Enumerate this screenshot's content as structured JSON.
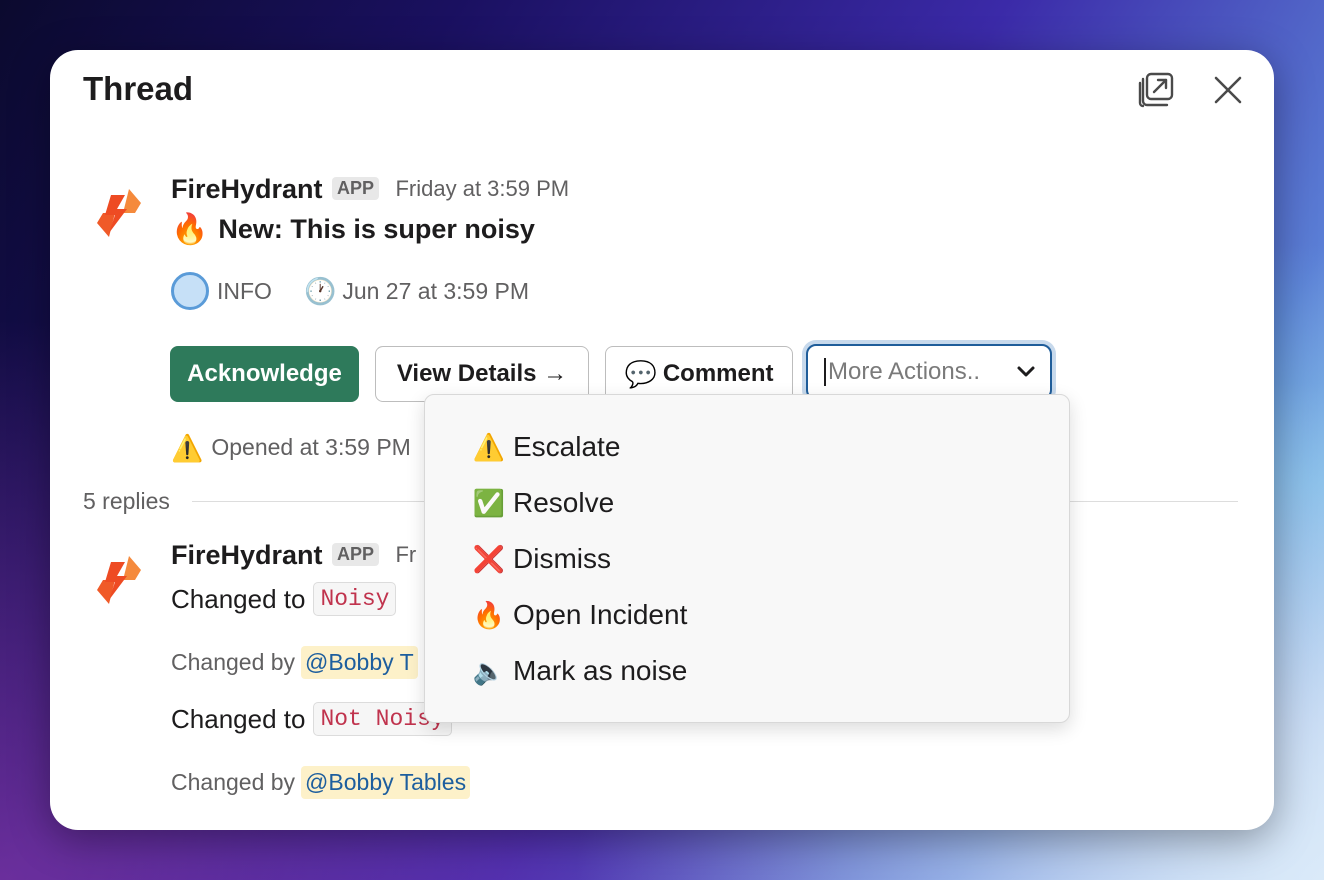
{
  "panel": {
    "title": "Thread"
  },
  "icons": {
    "popout": "popout-icon",
    "close": "close-icon"
  },
  "colors": {
    "acknowledge": "#2e7a5b",
    "mention_bg": "#fdf1c9",
    "mention_text": "#1d5e9e",
    "code_text": "#c0334d",
    "focus_ring": "#1f5d9a"
  },
  "message": {
    "sender": "FireHydrant",
    "badge": "APP",
    "time": "Friday at 3:59 PM",
    "title_emoji": "🔥",
    "title": "New: This is super noisy",
    "severity": "INFO",
    "clock_emoji": "🕐",
    "created_time": "Jun 27 at 3:59 PM",
    "warn_emoji": "⚠️",
    "opened": "Opened at 3:59 PM"
  },
  "actions": {
    "acknowledge": "Acknowledge",
    "view_details": "View Details →",
    "comment_emoji": "💬",
    "comment": "Comment",
    "more_actions": "More Actions.."
  },
  "menu": {
    "items": [
      {
        "emoji": "⚠️",
        "label": "Escalate"
      },
      {
        "emoji": "✅",
        "label": "Resolve"
      },
      {
        "emoji": "❌",
        "label": "Dismiss"
      },
      {
        "emoji": "🔥",
        "label": "Open Incident"
      },
      {
        "emoji": "🔈",
        "label": "Mark as noise"
      }
    ]
  },
  "replies": {
    "count_label": "5 replies",
    "reply": {
      "sender": "FireHydrant",
      "badge": "APP",
      "time_partial": "Fr",
      "changed_to_label": "Changed to",
      "value_1": "Noisy",
      "changed_by_label": "Changed by",
      "mention_1": "@Bobby T",
      "value_2": "Not Noisy",
      "mention_2": "@Bobby Tables"
    }
  }
}
